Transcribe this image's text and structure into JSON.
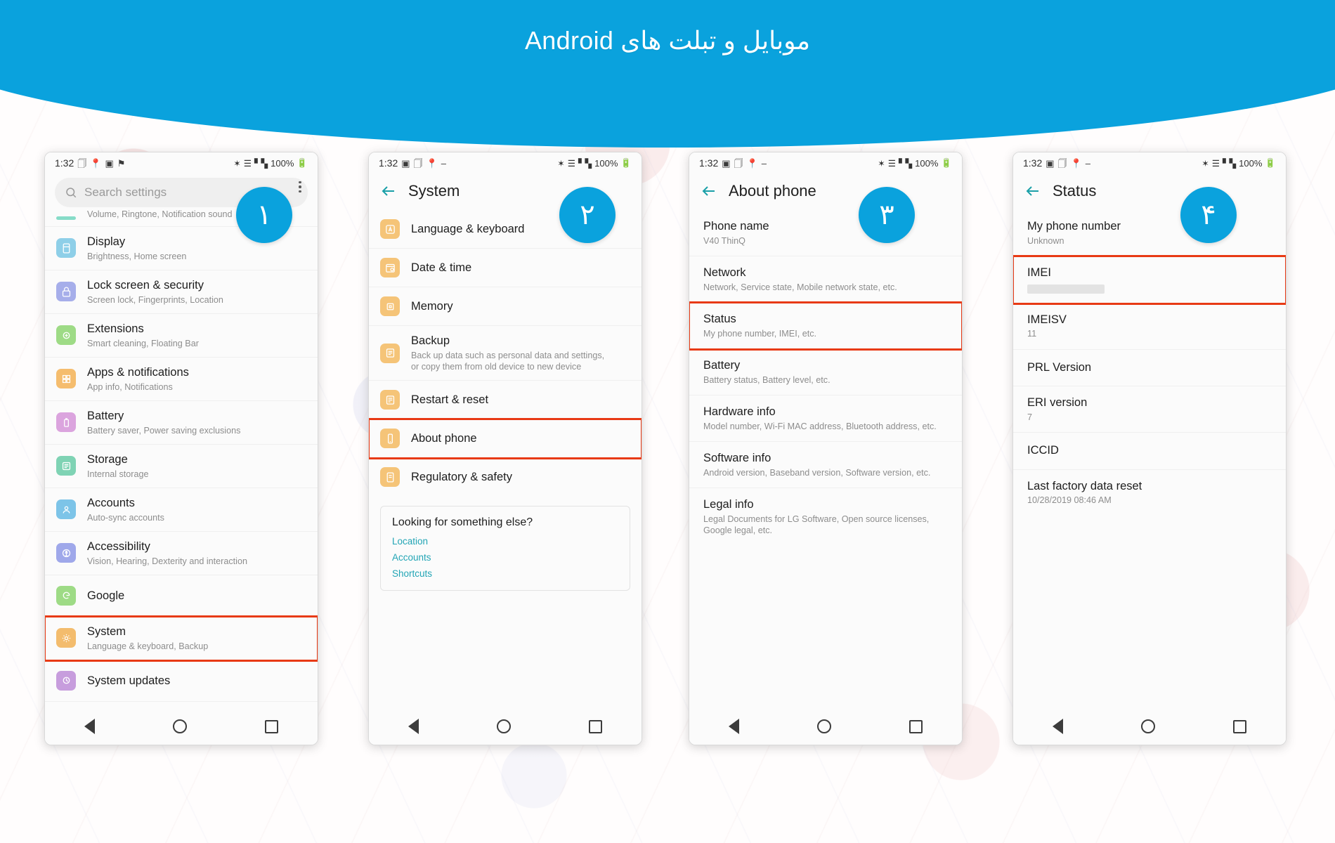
{
  "banner": {
    "title": "موبایل و تبلت های Android",
    "color": "#0aa2dd"
  },
  "badges": {
    "step1": "۱",
    "step2": "۲",
    "step3": "۳",
    "step4": "۴"
  },
  "statusbar": {
    "time": "1:32",
    "left_icons_1": [
      "copy-icon",
      "location-pin-icon",
      "image-icon",
      "flag-icon"
    ],
    "left_icons_other": [
      "image-icon",
      "copy-icon",
      "location-pin-icon",
      "dash-icon"
    ],
    "right_icons": [
      "bluetooth-icon",
      "wifi-icon",
      "signal-icon"
    ],
    "battery": "100%",
    "battery_icon": "battery-icon"
  },
  "navbar": {
    "back": "nav-back-triangle",
    "home": "nav-home-circle",
    "recents": "nav-recents-square"
  },
  "phone1": {
    "search": {
      "placeholder": "Search settings",
      "icon": "search-icon",
      "menu": "overflow-menu-icon"
    },
    "items": [
      {
        "title": "",
        "sub": "Volume, Ringtone, Notification sound",
        "icon": "sound-icon",
        "color": "#8ddcc8",
        "clipped": true
      },
      {
        "title": "Display",
        "sub": "Brightness, Home screen",
        "icon": "display-icon",
        "color": "#8ecfe8"
      },
      {
        "title": "Lock screen & security",
        "sub": "Screen lock, Fingerprints, Location",
        "icon": "lock-icon",
        "color": "#a6aeea"
      },
      {
        "title": "Extensions",
        "sub": "Smart cleaning, Floating Bar",
        "icon": "extensions-icon",
        "color": "#9edb86"
      },
      {
        "title": "Apps & notifications",
        "sub": "App info, Notifications",
        "icon": "apps-icon",
        "color": "#f5bd6e"
      },
      {
        "title": "Battery",
        "sub": "Battery saver, Power saving exclusions",
        "icon": "battery-icon",
        "color": "#dba4de"
      },
      {
        "title": "Storage",
        "sub": "Internal storage",
        "icon": "storage-icon",
        "color": "#7fd3b4"
      },
      {
        "title": "Accounts",
        "sub": "Auto-sync accounts",
        "icon": "accounts-icon",
        "color": "#7dc4e8"
      },
      {
        "title": "Accessibility",
        "sub": "Vision, Hearing, Dexterity and interaction",
        "icon": "accessibility-icon",
        "color": "#9fa8ea"
      },
      {
        "title": "Google",
        "sub": "",
        "icon": "google-icon",
        "color": "#9edb86"
      },
      {
        "title": "System",
        "sub": "Language & keyboard, Backup",
        "icon": "system-gear-icon",
        "color": "#f3bc6d",
        "highlight": true
      },
      {
        "title": "System updates",
        "sub": "",
        "icon": "system-updates-icon",
        "color": "#c79ddd"
      }
    ]
  },
  "phone2": {
    "title": "System",
    "back_icon": "back-arrow-icon",
    "items": [
      {
        "title": "Language & keyboard",
        "sub": "",
        "icon": "language-icon",
        "color": "#f5c478"
      },
      {
        "title": "Date & time",
        "sub": "",
        "icon": "calendar-clock-icon",
        "color": "#f5c478"
      },
      {
        "title": "Memory",
        "sub": "",
        "icon": "memory-chip-icon",
        "color": "#f5c478"
      },
      {
        "title": "Backup",
        "sub": "Back up data such as personal data and settings, or copy them from old device to new device",
        "icon": "backup-list-icon",
        "color": "#f5c478"
      },
      {
        "title": "Restart & reset",
        "sub": "",
        "icon": "restart-reset-icon",
        "color": "#f5c478"
      },
      {
        "title": "About phone",
        "sub": "",
        "icon": "about-phone-icon",
        "color": "#f5c478",
        "highlight": true
      },
      {
        "title": "Regulatory & safety",
        "sub": "",
        "icon": "regulatory-icon",
        "color": "#f5c478"
      }
    ],
    "card": {
      "title": "Looking for something else?",
      "links": [
        "Location",
        "Accounts",
        "Shortcuts"
      ]
    }
  },
  "phone3": {
    "title": "About phone",
    "back_icon": "back-arrow-icon",
    "items": [
      {
        "title": "Phone name",
        "sub": "V40 ThinQ"
      },
      {
        "title": "Network",
        "sub": "Network, Service state, Mobile network state, etc."
      },
      {
        "title": "Status",
        "sub": "My phone number, IMEI, etc.",
        "highlight": true
      },
      {
        "title": "Battery",
        "sub": "Battery status, Battery level, etc."
      },
      {
        "title": "Hardware info",
        "sub": "Model number, Wi-Fi MAC address, Bluetooth address, etc."
      },
      {
        "title": "Software info",
        "sub": "Android version, Baseband version, Software version, etc."
      },
      {
        "title": "Legal info",
        "sub": "Legal Documents for LG Software, Open source licenses, Google legal, etc."
      }
    ]
  },
  "phone4": {
    "title": "Status",
    "back_icon": "back-arrow-icon",
    "items": [
      {
        "title": "My phone number",
        "sub": "Unknown"
      },
      {
        "title": "IMEI",
        "sub": "",
        "redacted": true,
        "highlight": true
      },
      {
        "title": "IMEISV",
        "sub": "11"
      },
      {
        "title": "PRL Version",
        "sub": ""
      },
      {
        "title": "ERI version",
        "sub": "7"
      },
      {
        "title": "ICCID",
        "sub": ""
      },
      {
        "title": "Last factory data reset",
        "sub": "10/28/2019 08:46 AM"
      }
    ]
  }
}
